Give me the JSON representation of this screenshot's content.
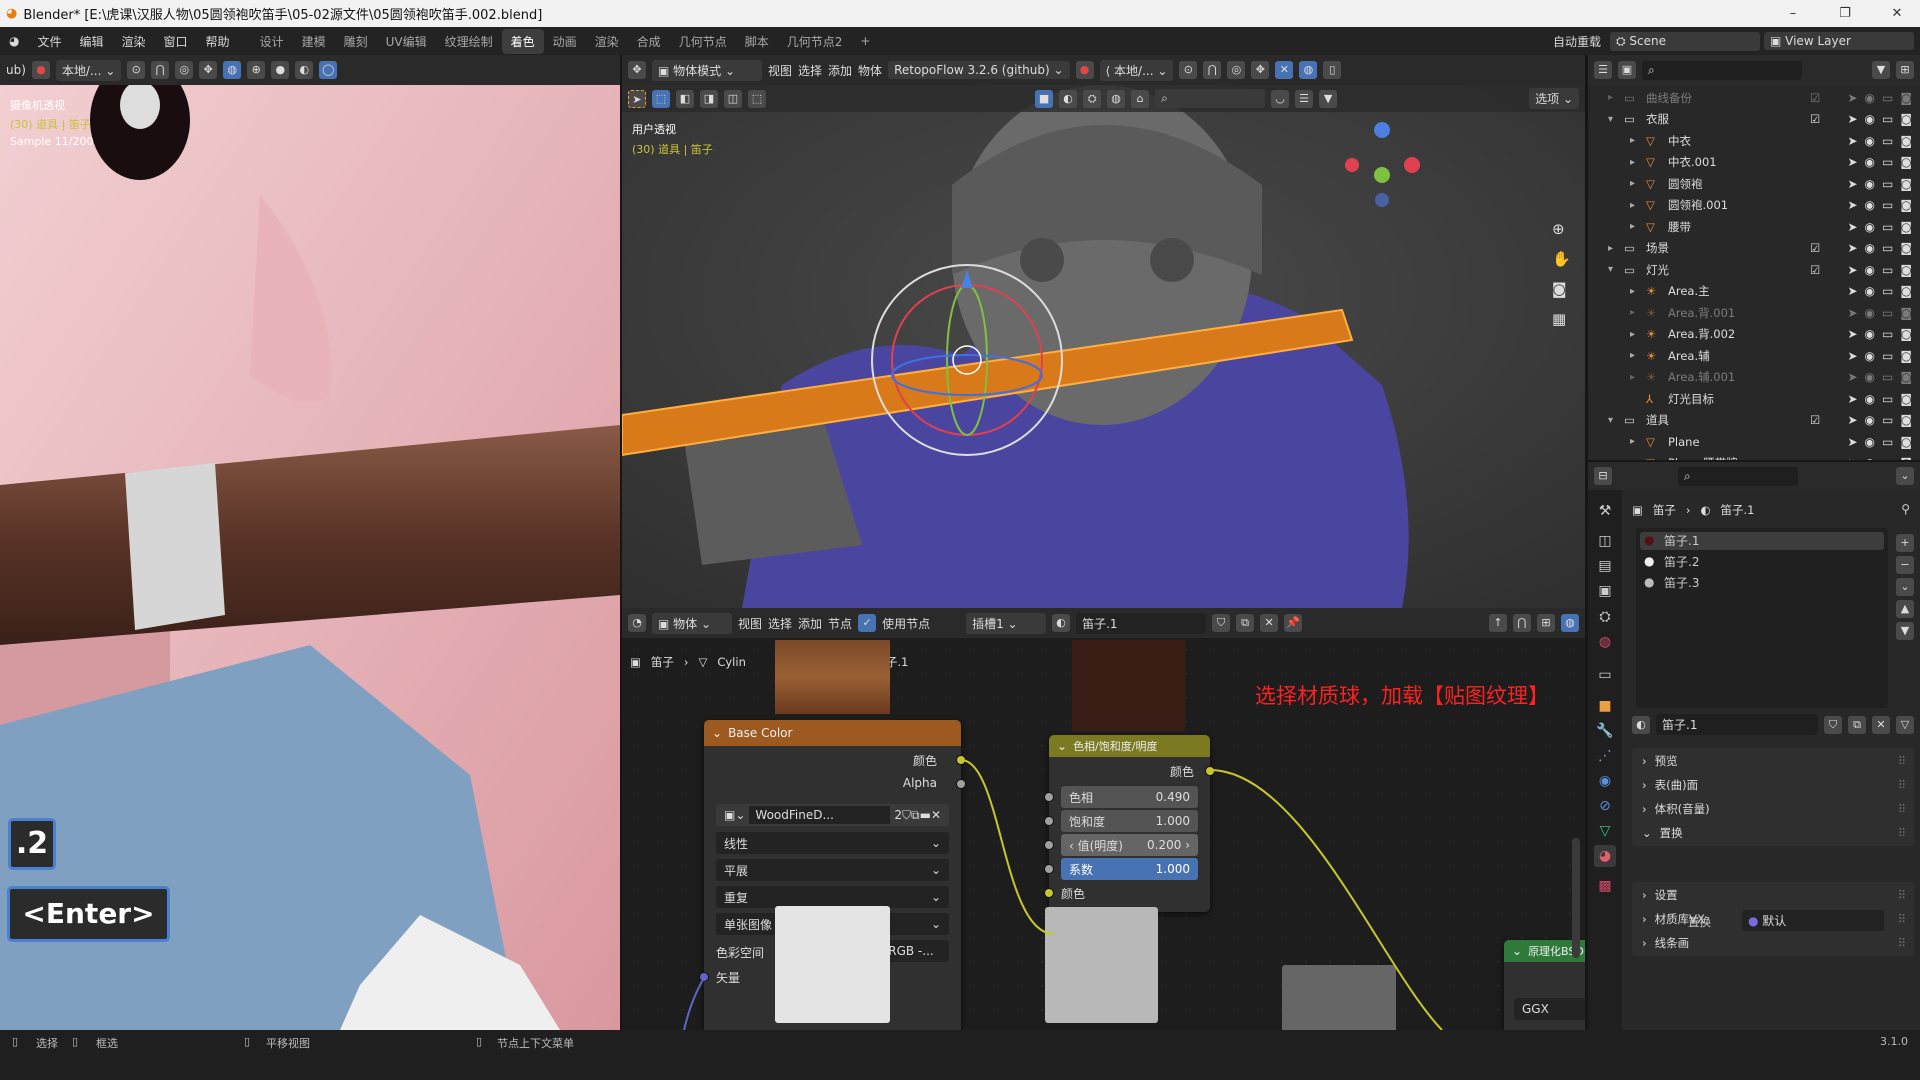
{
  "window": {
    "title": "Blender* [E:\\虎课\\汉服人物\\05圆领袍吹笛手\\05-02源文件\\05圆领袍吹笛手.002.blend]",
    "minimize": "–",
    "maximize": "❐",
    "close": "✕"
  },
  "menu": {
    "items": [
      "文件",
      "编辑",
      "渲染",
      "窗口",
      "帮助"
    ],
    "workspaces": [
      "设计",
      "建模",
      "雕刻",
      "UV编辑",
      "纹理绘制",
      "着色",
      "动画",
      "渲染",
      "合成",
      "几何节点",
      "脚本",
      "几何节点2"
    ],
    "active_workspace": "着色",
    "add_tab": "+",
    "auto_reload": "自动重载",
    "scene": "Scene",
    "view_layer": "View Layer"
  },
  "left_view": {
    "header_prefix": "ub)",
    "transform": "本地/...",
    "overlay_lines": [
      "摄像机透视",
      "(30) 道具 | 笛子",
      "Sample 11/200"
    ],
    "key_hint_1": ".2",
    "key_hint_2": "<Enter>"
  },
  "viewport": {
    "mode": "物体模式",
    "menus": [
      "视图",
      "选择",
      "添加",
      "物体"
    ],
    "addon": "RetopoFlow 3.2.6 (github)",
    "transform": "本地/...",
    "options": "选项",
    "view_name": "用户透视",
    "object_info": "(30) 道具 | 笛子",
    "gizmo_axes": [
      "X",
      "Y",
      "Z"
    ]
  },
  "node_editor": {
    "editor_type": "物体",
    "menus": [
      "视图",
      "选择",
      "添加",
      "节点"
    ],
    "use_nodes_label": "使用节点",
    "use_nodes": true,
    "slot": "插槽1",
    "material": "笛子.1",
    "breadcrumb": [
      "笛子",
      "Cylin",
      "子.1"
    ],
    "annotation": "选择材质球，加载【贴图纹理】",
    "image_node": {
      "title": "Base Color",
      "out_color": "颜色",
      "out_alpha": "Alpha",
      "image": "WoodFineD...",
      "users": "2",
      "interpolation": "线性",
      "projection": "平展",
      "extension": "重复",
      "source": "单张图像",
      "colorspace_label": "色彩空间",
      "colorspace": "sRGB -...",
      "in_vector": "矢量",
      "header_color": "#9c5a21"
    },
    "hsv_node": {
      "title": "色相/饱和度/明度",
      "out_color": "颜色",
      "hue_label": "色相",
      "hue": "0.490",
      "sat_label": "饱和度",
      "sat": "1.000",
      "val_label": "值(明度)",
      "val": "0.200",
      "fac_label": "系数",
      "fac": "1.000",
      "in_color": "颜色",
      "header_color": "#7b7a22"
    },
    "bsdf_node": {
      "title": "原理化BSDF",
      "distribution": "GGX",
      "header_color": "#2f7a3a"
    }
  },
  "outliner": {
    "rows": [
      {
        "name": "曲线备份",
        "type": "collection",
        "depth": 0,
        "dim": true,
        "checked": true
      },
      {
        "name": "衣服",
        "type": "collection",
        "depth": 0,
        "expanded": true,
        "checked": true
      },
      {
        "name": "中衣",
        "type": "mesh",
        "depth": 1
      },
      {
        "name": "中衣.001",
        "type": "mesh",
        "depth": 1
      },
      {
        "name": "圆领袍",
        "type": "mesh",
        "depth": 1
      },
      {
        "name": "圆领袍.001",
        "type": "mesh",
        "depth": 1
      },
      {
        "name": "腰带",
        "type": "mesh",
        "depth": 1
      },
      {
        "name": "场景",
        "type": "collection",
        "depth": 0,
        "checked": true
      },
      {
        "name": "灯光",
        "type": "collection",
        "depth": 0,
        "expanded": true,
        "checked": true
      },
      {
        "name": "Area.主",
        "type": "light",
        "depth": 1
      },
      {
        "name": "Area.背.001",
        "type": "light",
        "depth": 1,
        "dim": true
      },
      {
        "name": "Area.背.002",
        "type": "light",
        "depth": 1
      },
      {
        "name": "Area.辅",
        "type": "light",
        "depth": 1
      },
      {
        "name": "Area.辅.001",
        "type": "light",
        "depth": 1,
        "dim": true
      },
      {
        "name": "灯光目标",
        "type": "empty",
        "depth": 1
      },
      {
        "name": "道具",
        "type": "collection",
        "depth": 0,
        "expanded": true,
        "checked": true
      },
      {
        "name": "Plane",
        "type": "mesh",
        "depth": 1
      },
      {
        "name": "Plane.腰带牌",
        "type": "mesh",
        "depth": 1
      }
    ]
  },
  "properties": {
    "breadcrumb": [
      "笛子",
      "笛子.1"
    ],
    "slots": [
      "笛子.1",
      "笛子.2",
      "笛子.3"
    ],
    "active_slot": "笛子.1",
    "material": "笛子.1",
    "panels": [
      "预览",
      "表(曲)面",
      "体积(音量)",
      "置换",
      "设置",
      "材质库VX",
      "线条画"
    ],
    "displacement_label": "置换",
    "displacement_value": "默认"
  },
  "status": {
    "items": [
      "选择",
      "框选",
      "平移视图",
      "节点上下文菜单"
    ],
    "version": "3.1.0"
  },
  "colors": {
    "accent": "#4772b3",
    "flute_select": "#ff8a1a",
    "annotation": "#ff2020"
  }
}
